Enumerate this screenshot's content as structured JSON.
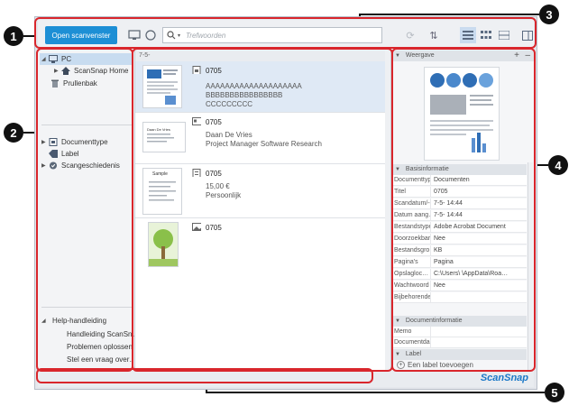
{
  "callouts": [
    "1",
    "2",
    "3",
    "4",
    "5"
  ],
  "toolbar": {
    "open_button": "Open scanvenster",
    "search_placeholder": "Trefwoorden"
  },
  "sidebar": {
    "pc": "PC",
    "scansnap_home": "ScanSnap Home",
    "trash": "Prullenbak",
    "doctype": "Documenttype",
    "label": "Label",
    "history": "Scangeschiedenis",
    "help": "Help-handleiding",
    "help_items": [
      "Handleiding ScanSn…",
      "Problemen oplossen",
      "Stel een vraag over…"
    ]
  },
  "list": {
    "date_header": "7-5-",
    "rows": [
      {
        "title": "0705",
        "lines": [
          "AAAAAAAAAAAAAAAAAAAA",
          "BBBBBBBBBBBBBBBB",
          "CCCCCCCCC"
        ]
      },
      {
        "title": "0705",
        "lines": [
          "Daan De Vries",
          "Project Manager Software Research"
        ]
      },
      {
        "title": "0705",
        "lines": [
          "15,00 €",
          "Persoonlijk"
        ]
      },
      {
        "title": "0705",
        "lines": []
      }
    ],
    "card_name": "Daan De Vries",
    "receipt_title": "Sample"
  },
  "details": {
    "weergave": "Weergave",
    "basis": "Basisinformatie",
    "props": [
      {
        "k": "Documenttype",
        "v": "Documenten"
      },
      {
        "k": "Titel",
        "v": "0705"
      },
      {
        "k": "Scandatum/-…",
        "v": "7-5-      14:44"
      },
      {
        "k": "Datum aang…",
        "v": "7-5-      14:44"
      },
      {
        "k": "Bestandstype",
        "v": "Adobe Acrobat Document"
      },
      {
        "k": "Doorzoekbar…",
        "v": "Nee"
      },
      {
        "k": "Bestandsgro…",
        "v": "KB"
      },
      {
        "k": "Pagina's",
        "v": "Pagina"
      },
      {
        "k": "Opslagloc…",
        "v": "C:\\Users\\    \\AppData\\Roa…"
      },
      {
        "k": "Wachtwoord",
        "v": "Nee"
      },
      {
        "k": "Bijbehorende…",
        "v": ""
      }
    ],
    "docinfo": "Documentinformatie",
    "docprops": [
      {
        "k": "Memo",
        "v": ""
      },
      {
        "k": "Documentda…",
        "v": ""
      }
    ],
    "label": "Label",
    "add_label": "Een label toevoegen"
  },
  "status": {
    "brand": "ScanSnap"
  },
  "colors": {
    "accent": "#1d8fd5",
    "callout_box": "#d9262c"
  }
}
